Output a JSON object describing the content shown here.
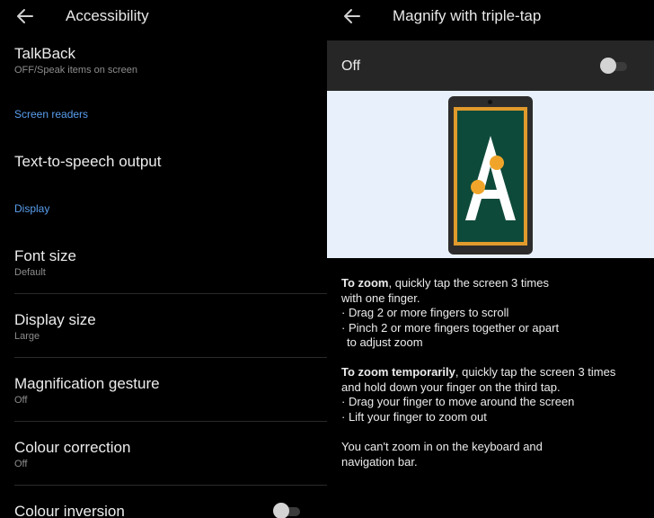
{
  "left_panel": {
    "title": "Accessibility",
    "talkback": {
      "title": "TalkBack",
      "sub": "OFF/Speak items on screen"
    },
    "section_screen_readers": "Screen readers",
    "tts": {
      "title": "Text-to-speech output"
    },
    "section_display": "Display",
    "font_size": {
      "title": "Font size",
      "sub": "Default"
    },
    "display_size": {
      "title": "Display size",
      "sub": "Large"
    },
    "magnification": {
      "title": "Magnification gesture",
      "sub": "Off"
    },
    "colour_correction": {
      "title": "Colour correction",
      "sub": "Off"
    },
    "colour_inversion": {
      "title": "Colour inversion",
      "enabled": false
    }
  },
  "right_panel": {
    "title": "Magnify with triple-tap",
    "switch_label": "Off",
    "switch_enabled": false,
    "illustration_letter": "A",
    "zoom": {
      "heading": "To zoom",
      "text": ", quickly tap the screen 3 times",
      "text2": "with one finger.",
      "bullet1": "· Drag 2 or more fingers to scroll",
      "bullet2": "· Pinch 2 or more fingers together or apart",
      "bullet2b": "to adjust zoom"
    },
    "zoom_temp": {
      "heading": "To zoom temporarily",
      "text": ", quickly tap the screen 3 times",
      "text2": "and hold down your finger on the third tap.",
      "bullet1": "· Drag your finger to move around the screen",
      "bullet2": "· Lift your finger to zoom out"
    },
    "note_line1": "You can't zoom in on the keyboard and",
    "note_line2": "navigation bar."
  },
  "colors": {
    "background": "#000000",
    "accent_blue": "#5a9ff0",
    "phone_frame": "#e19a2c",
    "phone_screen": "#0e4a3a",
    "tap_dot": "#f0a52a",
    "illustration_bg": "#e8f1fb"
  },
  "icons": [
    "arrow-left-icon",
    "phone-illustration",
    "toggle-switch"
  ]
}
